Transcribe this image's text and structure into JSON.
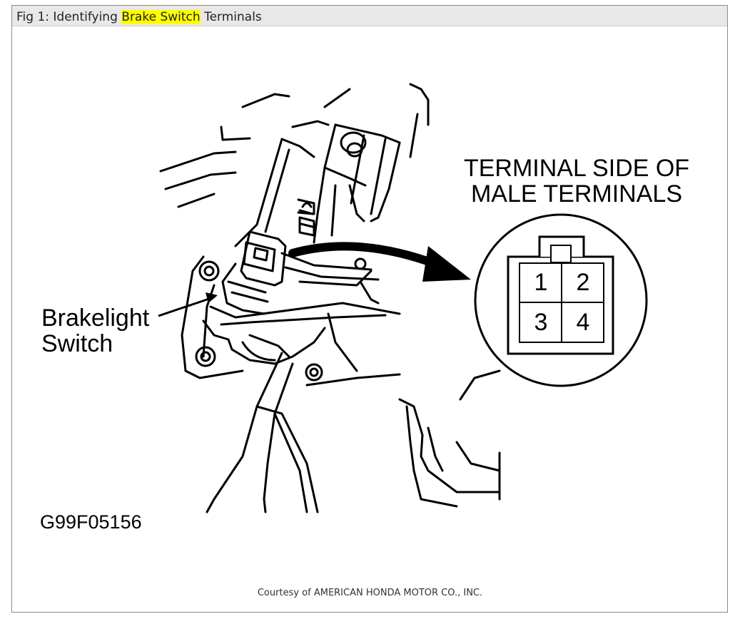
{
  "caption": {
    "prefix": "Fig 1: Identifying ",
    "highlight": "Brake Switch",
    "suffix": " Terminals"
  },
  "labels": {
    "terminal_line1": "TERMINAL SIDE OF",
    "terminal_line2": "MALE TERMINALS",
    "switch_line1": "Brakelight",
    "switch_line2": "Switch",
    "figure_code": "G99F05156"
  },
  "terminals": [
    "1",
    "2",
    "3",
    "4"
  ],
  "courtesy": "Courtesy of AMERICAN HONDA MOTOR CO., INC."
}
